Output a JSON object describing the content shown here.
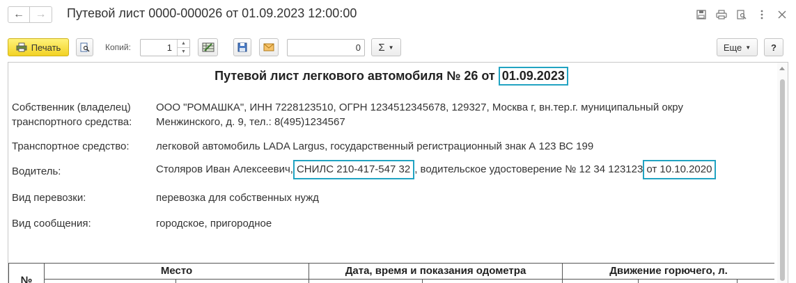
{
  "window": {
    "back_glyph": "←",
    "forward_glyph": "→",
    "title": "Путевой лист 0000-000026 от 01.09.2023 12:00:00",
    "icons": [
      "save-icon",
      "print-icon",
      "preview-icon",
      "more-vertical-icon",
      "close-icon"
    ]
  },
  "toolbar": {
    "print_label": "Печать",
    "copies_label": "Копий:",
    "copies_value": "1",
    "sum_value": "0",
    "sigma_label": "Σ",
    "more_label": "Еще",
    "help_label": "?"
  },
  "document": {
    "title_text": "Путевой лист легкового автомобиля № 26 от ",
    "title_date": "01.09.2023",
    "owner_label_1": "Собственник (владелец)",
    "owner_label_2": "транспортного средства:",
    "owner_value_1": "ООО \"РОМАШКА\", ИНН 7228123510, ОГРН 1234512345678, 129327, Москва г, вн.тер.г. муниципальный окру",
    "owner_value_2": "Менжинского, д. 9, тел.: 8(495)1234567",
    "vehicle_label": "Транспортное средство:",
    "vehicle_value": "легковой автомобиль LADA Largus, государственный регистрационный знак А 123 ВС 199",
    "driver_label": "Водитель:",
    "driver_name": "Столяров Иван Алексеевич,",
    "driver_snils": "СНИЛС 210-417-547 32",
    "driver_license": ", водительское удостоверение № 12 34 123123",
    "driver_license_date": "от 10.10.2020",
    "transport_label": "Вид перевозки:",
    "transport_value": "перевозка для собственных нужд",
    "message_label": "Вид сообщения:",
    "message_value": "городское, пригородное"
  },
  "table": {
    "col_num": "№",
    "col_place": "Место",
    "col_datetime": "Дата, время и показания одометра",
    "col_fuel": "Движение горючего, л."
  },
  "colors": {
    "highlight": "#21a3c2",
    "print_button": "#f5d829"
  }
}
